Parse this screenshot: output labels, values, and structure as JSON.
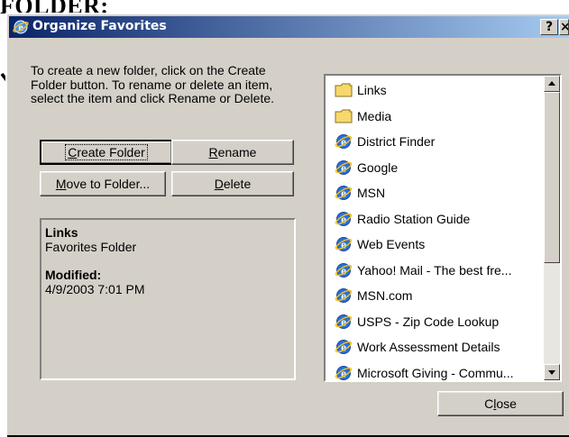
{
  "caption_fragment": "FOLDER:",
  "window": {
    "title": "Organize Favorites",
    "help_glyph": "?",
    "close_glyph": "×"
  },
  "instructions": "To create a new folder, click on the Create Folder button. To rename or delete an item, select the item and click Rename or Delete.",
  "buttons": {
    "create_folder": {
      "prefix": "",
      "accel": "C",
      "rest": "reate Folder"
    },
    "rename": {
      "prefix": "",
      "accel": "R",
      "rest": "ename"
    },
    "move_to_folder": {
      "prefix": "",
      "accel": "M",
      "rest": "ove to Folder..."
    },
    "delete": {
      "prefix": "",
      "accel": "D",
      "rest": "elete"
    },
    "close": {
      "prefix": "C",
      "accel": "l",
      "rest": "ose"
    }
  },
  "info": {
    "name": "Links",
    "type": "Favorites Folder",
    "modified_label": "Modified:",
    "modified_value": "4/9/2003 7:01 PM"
  },
  "favorites": [
    {
      "label": "Links",
      "icon": "folder-icon"
    },
    {
      "label": "Media",
      "icon": "folder-icon"
    },
    {
      "label": "District Finder",
      "icon": "ie-icon"
    },
    {
      "label": "Google",
      "icon": "ie-icon"
    },
    {
      "label": "MSN",
      "icon": "ie-icon"
    },
    {
      "label": "Radio Station Guide",
      "icon": "ie-icon"
    },
    {
      "label": "Web Events",
      "icon": "ie-icon"
    },
    {
      "label": "Yahoo! Mail - The best fre...",
      "icon": "ie-icon"
    },
    {
      "label": "MSN.com",
      "icon": "ie-icon"
    },
    {
      "label": "USPS - Zip Code Lookup",
      "icon": "ie-icon"
    },
    {
      "label": "Work Assessment Details",
      "icon": "ie-icon"
    },
    {
      "label": "Microsoft Giving - Commu...",
      "icon": "ie-icon"
    }
  ],
  "colors": {
    "titlebar_start": "#0a246a",
    "titlebar_end": "#a6caf0",
    "dialog_face": "#d4d0c8",
    "folder_yellow": "#f6d86b",
    "ie_blue": "#2a6fd6"
  }
}
